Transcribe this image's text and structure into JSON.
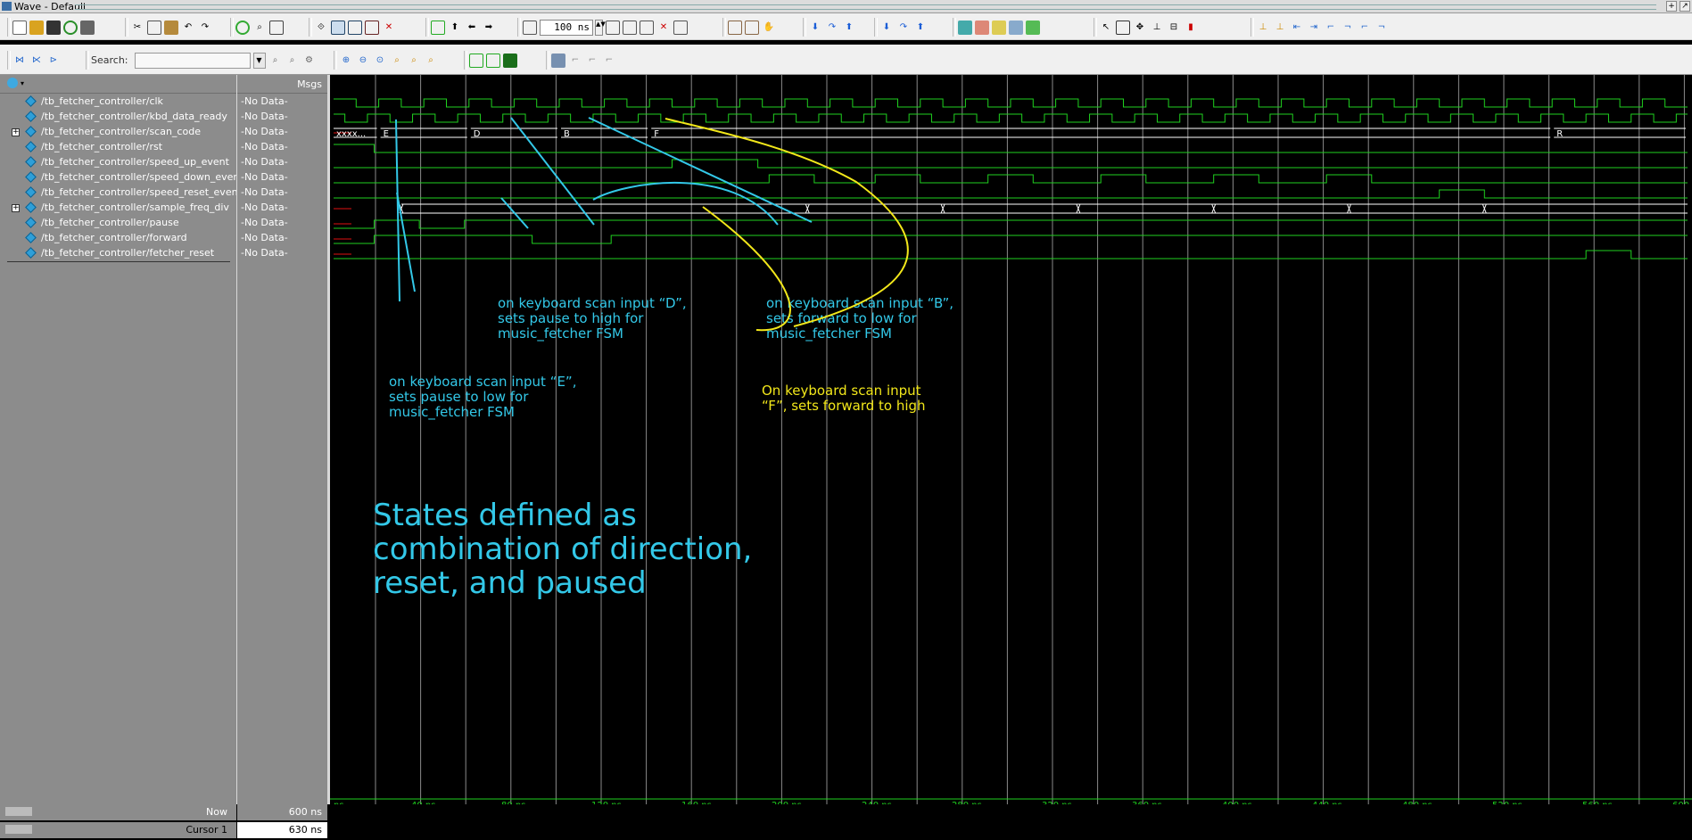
{
  "window": {
    "title": "Wave - Default"
  },
  "toolbar": {
    "zoom_value": "100 ns",
    "search_label": "Search:",
    "search_value": ""
  },
  "panes": {
    "msgs_header": "Msgs"
  },
  "signals": [
    {
      "name": "/tb_fetcher_controller/clk",
      "value": "-No Data-",
      "expandable": false
    },
    {
      "name": "/tb_fetcher_controller/kbd_data_ready",
      "value": "-No Data-",
      "expandable": false
    },
    {
      "name": "/tb_fetcher_controller/scan_code",
      "value": "-No Data-",
      "expandable": true
    },
    {
      "name": "/tb_fetcher_controller/rst",
      "value": "-No Data-",
      "expandable": false
    },
    {
      "name": "/tb_fetcher_controller/speed_up_event",
      "value": "-No Data-",
      "expandable": false
    },
    {
      "name": "/tb_fetcher_controller/speed_down_event",
      "value": "-No Data-",
      "expandable": false
    },
    {
      "name": "/tb_fetcher_controller/speed_reset_event",
      "value": "-No Data-",
      "expandable": false
    },
    {
      "name": "/tb_fetcher_controller/sample_freq_div",
      "value": "-No Data-",
      "expandable": true
    },
    {
      "name": "/tb_fetcher_controller/pause",
      "value": "-No Data-",
      "expandable": false
    },
    {
      "name": "/tb_fetcher_controller/forward",
      "value": "-No Data-",
      "expandable": false
    },
    {
      "name": "/tb_fetcher_controller/fetcher_reset",
      "value": "-No Data-",
      "expandable": false
    }
  ],
  "bus_values": {
    "scan_code": [
      "xxxx...",
      "E",
      "D",
      "B",
      "F",
      "R"
    ]
  },
  "timeline": {
    "ticks": [
      "ns",
      "40 ns",
      "80 ns",
      "120 ns",
      "160 ns",
      "200 ns",
      "240 ns",
      "280 ns",
      "320 ns",
      "360 ns",
      "400 ns",
      "440 ns",
      "480 ns",
      "520 ns",
      "560 ns",
      "600"
    ]
  },
  "status": {
    "now_label": "Now",
    "now_value": "600 ns",
    "cursor_label": "Cursor 1",
    "cursor_value": "630 ns"
  },
  "annotations": {
    "e": [
      "on keyboard scan input “E”,",
      "sets pause to low for",
      "music_fetcher FSM"
    ],
    "d": [
      "on keyboard scan input “D”,",
      "sets pause to high for",
      "music_fetcher FSM"
    ],
    "b": [
      "on keyboard scan input “B”,",
      "sets forward to low for",
      "music_fetcher FSM"
    ],
    "f": [
      "On keyboard scan input",
      "“F”, sets forward to high"
    ],
    "states": [
      "States defined as",
      "combination of direction,",
      "reset, and paused"
    ]
  },
  "colors": {
    "wave_green": "#1fd11f",
    "bus_white": "#ffffff",
    "cursor_grey": "#8a8a8a",
    "note_cyan": "#33c8e8",
    "note_yellow": "#f2e71a",
    "undefined_red": "#e01010"
  }
}
